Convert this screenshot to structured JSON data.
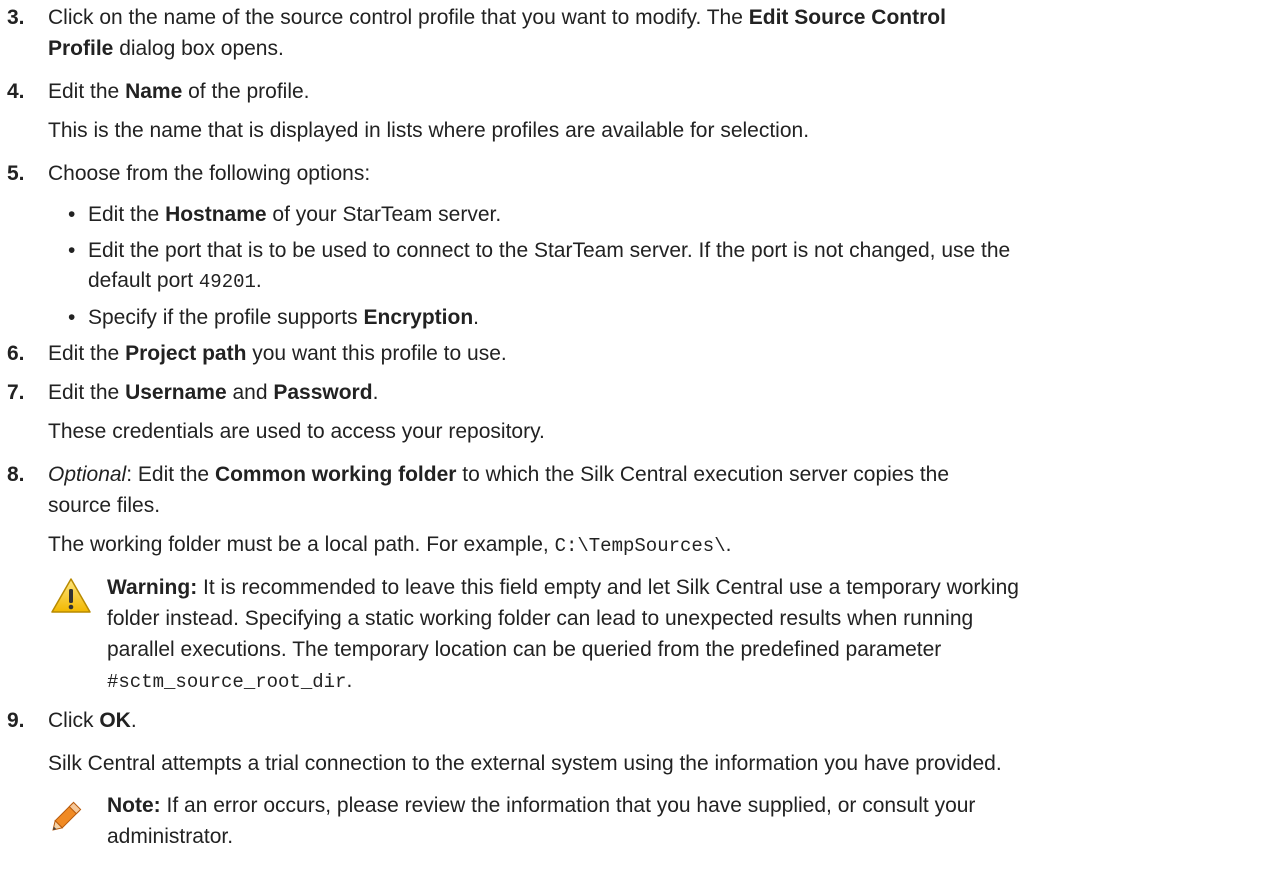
{
  "steps": {
    "s3": {
      "num": "3.",
      "l1_a": "Click on the name of the source control profile that you want to modify. The ",
      "l1_b": "Edit Source Control",
      "l2_a": "Profile",
      "l2_b": " dialog box opens."
    },
    "s4": {
      "num": "4.",
      "l1_a": "Edit the ",
      "l1_b": "Name",
      "l1_c": " of the profile.",
      "p": "This is the name that is displayed in lists where profiles are available for selection."
    },
    "s5": {
      "num": "5.",
      "l1": "Choose from the following options:",
      "b1_a": "Edit the ",
      "b1_b": "Hostname",
      "b1_c": " of your StarTeam server.",
      "b2_l1": "Edit the port that is to be used to connect to the StarTeam server. If the port is not changed, use the",
      "b2_l2_a": "default port ",
      "b2_l2_b": "49201",
      "b2_l2_c": ".",
      "b3_a": "Specify if the profile supports ",
      "b3_b": "Encryption",
      "b3_c": "."
    },
    "s6": {
      "num": "6.",
      "a": "Edit the ",
      "b": "Project path",
      "c": " you want this profile to use."
    },
    "s7": {
      "num": "7.",
      "a": "Edit the ",
      "b": "Username",
      "c": " and ",
      "d": "Password",
      "e": ".",
      "p": "These credentials are used to access your repository."
    },
    "s8": {
      "num": "8.",
      "l1_a": "Optional",
      "l1_b": ": Edit the ",
      "l1_c": "Common working folder",
      "l1_d": " to which the Silk Central execution server copies the",
      "l2": "source files.",
      "p_a": "The working folder must be a local path. For example, ",
      "p_b": "C:\\TempSources\\",
      "p_c": ".",
      "warn_label": "Warning:",
      "warn_l1": " It is recommended to leave this field empty and let Silk Central use a temporary working",
      "warn_l2": "folder instead. Specifying a static working folder can lead to unexpected results when running",
      "warn_l3": "parallel executions. The temporary location can be queried from the predefined parameter",
      "warn_l4_a": "#sctm_source_root_dir",
      "warn_l4_b": "."
    },
    "s9": {
      "num": "9.",
      "a": "Click ",
      "b": "OK",
      "c": ".",
      "p": "Silk Central attempts a trial connection to the external system using the information you have provided.",
      "note_label": "Note:",
      "note_l1": " If an error occurs, please review the information that you have supplied, or consult your",
      "note_l2": "administrator."
    }
  },
  "colors": {
    "text": "#222222",
    "warning_yellow": "#f2c200",
    "note_orange": "#e8731a"
  },
  "icons": {
    "warning": "warning-triangle-icon",
    "note": "pencil-note-icon"
  }
}
